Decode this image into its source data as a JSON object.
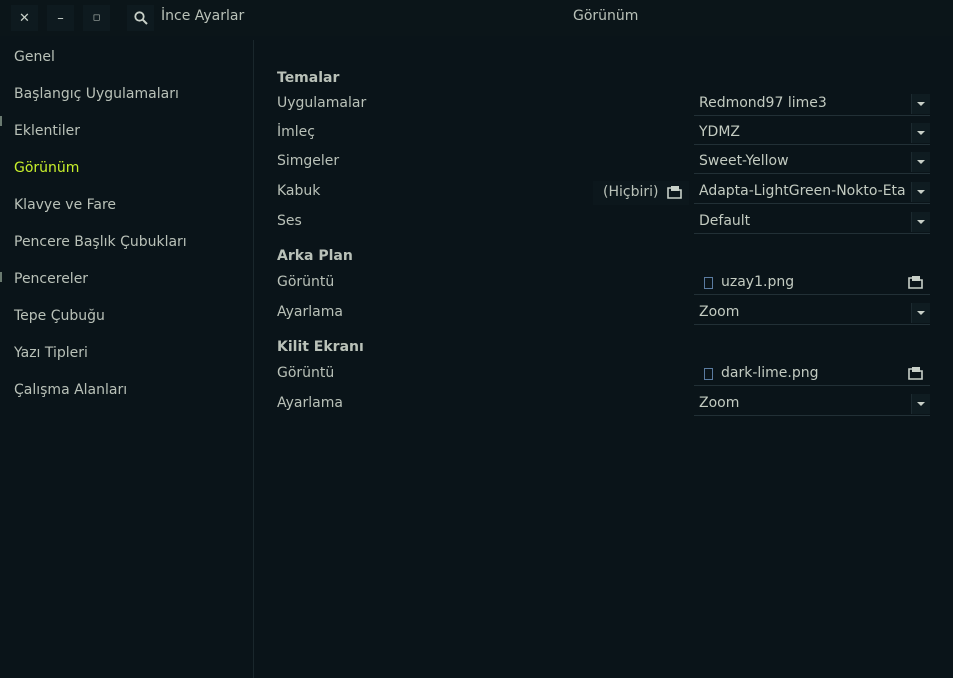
{
  "window": {
    "app_title": "İnce Ayarlar",
    "page_title": "Görünüm",
    "close_glyph": "✕",
    "minimize_glyph": "–",
    "maximize_glyph": "◻"
  },
  "sidebar": {
    "items": [
      {
        "label": "Genel"
      },
      {
        "label": "Başlangıç Uygulamaları"
      },
      {
        "label": "Eklentiler"
      },
      {
        "label": "Görünüm"
      },
      {
        "label": "Klavye ve Fare"
      },
      {
        "label": "Pencere Başlık Çubukları"
      },
      {
        "label": "Pencereler"
      },
      {
        "label": "Tepe Çubuğu"
      },
      {
        "label": "Yazı Tipleri"
      },
      {
        "label": "Çalışma Alanları"
      }
    ],
    "active_index": 3
  },
  "themes": {
    "heading": "Temalar",
    "applications": {
      "label": "Uygulamalar",
      "value": "Redmond97 lime3"
    },
    "cursor": {
      "label": "İmleç",
      "value": "YDMZ"
    },
    "icons": {
      "label": "Simgeler",
      "value": "Sweet-Yellow"
    },
    "shell": {
      "label": "Kabuk",
      "none_label": "(Hiçbiri)",
      "value": "Adapta-LightGreen-Nokto-Eta"
    },
    "sound": {
      "label": "Ses",
      "value": "Default"
    }
  },
  "background": {
    "heading": "Arka Plan",
    "image": {
      "label": "Görüntü",
      "value": "uzay1.png"
    },
    "adjustment": {
      "label": "Ayarlama",
      "value": "Zoom"
    }
  },
  "lock_screen": {
    "heading": "Kilit Ekranı",
    "image": {
      "label": "Görüntü",
      "value": "dark-lime.png"
    },
    "adjustment": {
      "label": "Ayarlama",
      "value": "Zoom"
    }
  },
  "colors": {
    "accent": "#c8f02b",
    "background": "#0a1419",
    "text": "#b9c1b8"
  }
}
